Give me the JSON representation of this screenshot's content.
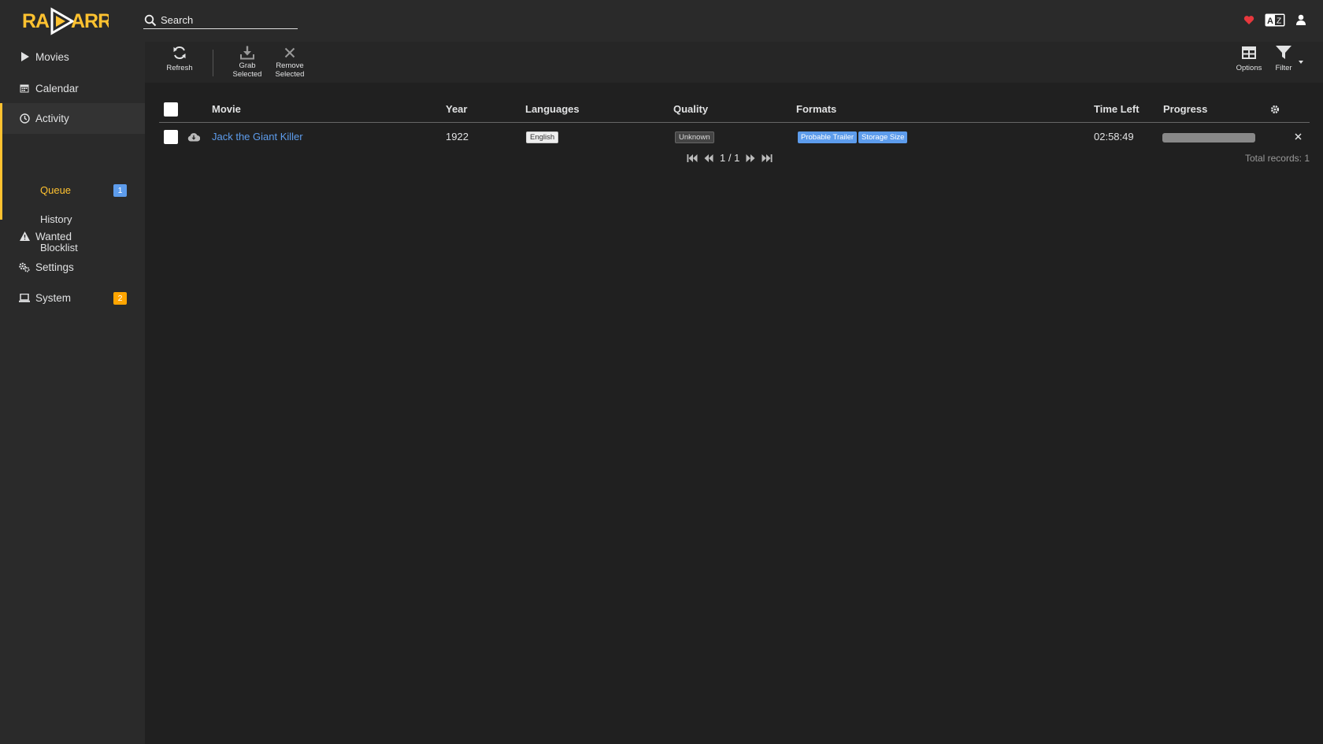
{
  "app": {
    "name": "Radarr"
  },
  "header": {
    "search_placeholder": "Search"
  },
  "sidebar": {
    "items": [
      {
        "label": "Movies"
      },
      {
        "label": "Calendar"
      },
      {
        "label": "Activity"
      },
      {
        "label": "Wanted"
      },
      {
        "label": "Settings"
      },
      {
        "label": "System",
        "badge": "2"
      }
    ],
    "activity_sub": [
      {
        "label": "Queue",
        "badge": "1"
      },
      {
        "label": "History"
      },
      {
        "label": "Blocklist"
      }
    ]
  },
  "toolbar": {
    "refresh": "Refresh",
    "grab_1": "Grab",
    "grab_2": "Selected",
    "remove_1": "Remove",
    "remove_2": "Selected",
    "options": "Options",
    "filter": "Filter"
  },
  "table": {
    "headers": {
      "movie": "Movie",
      "year": "Year",
      "languages": "Languages",
      "quality": "Quality",
      "formats": "Formats",
      "time_left": "Time Left",
      "progress": "Progress"
    },
    "rows": [
      {
        "movie": "Jack the Giant Killer",
        "year": "1922",
        "language": "English",
        "quality": "Unknown",
        "formats": [
          "Probable Trailer",
          "Storage Size"
        ],
        "time_left": "02:58:49",
        "progress": 1.0
      }
    ]
  },
  "pager": {
    "text": "1 / 1"
  },
  "total_records": "Total records: 1",
  "colors": {
    "accent": "#ffc230",
    "link": "#5d9cec",
    "badge_orange": "#ffa500"
  }
}
